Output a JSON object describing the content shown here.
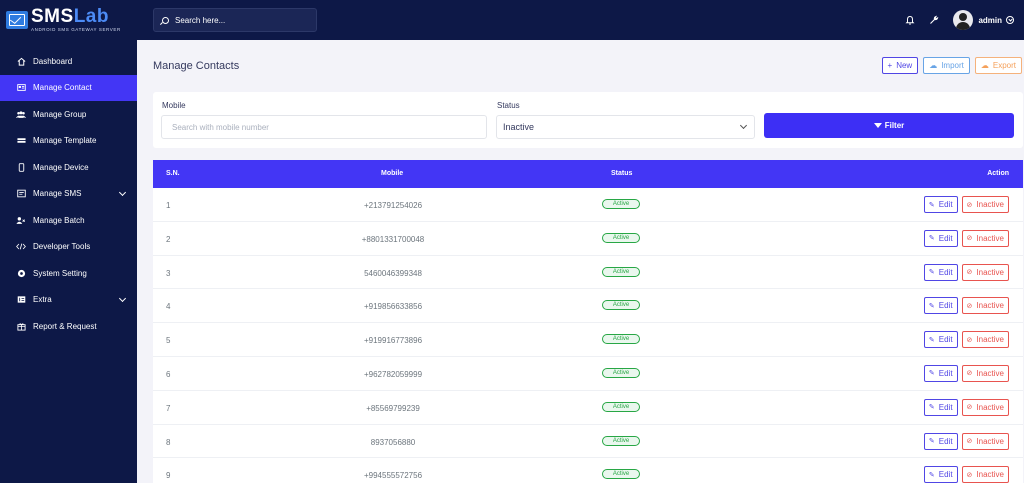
{
  "brand": {
    "name_main": "SMS",
    "name_accent": "Lab",
    "tagline": "ANDROID SMS GATEWAY SERVER"
  },
  "sidebar": {
    "items": [
      {
        "label": "Dashboard",
        "icon": "home-icon"
      },
      {
        "label": "Manage Contact",
        "icon": "contact-card-icon",
        "active": true
      },
      {
        "label": "Manage Group",
        "icon": "group-icon"
      },
      {
        "label": "Manage Template",
        "icon": "template-icon"
      },
      {
        "label": "Manage Device",
        "icon": "phone-icon"
      },
      {
        "label": "Manage SMS",
        "icon": "message-icon",
        "has_submenu": true
      },
      {
        "label": "Manage Batch",
        "icon": "batch-icon"
      },
      {
        "label": "Developer Tools",
        "icon": "code-icon"
      },
      {
        "label": "System Setting",
        "icon": "settings-icon"
      },
      {
        "label": "Extra",
        "icon": "extra-icon",
        "has_submenu": true
      },
      {
        "label": "Report & Request",
        "icon": "report-icon"
      }
    ]
  },
  "topbar": {
    "search_placeholder": "Search here...",
    "user_name": "admin"
  },
  "page": {
    "title": "Manage Contacts",
    "buttons": {
      "new": "New",
      "import": "Import",
      "export": "Export"
    }
  },
  "filter": {
    "mobile_label": "Mobile",
    "mobile_placeholder": "Search with mobile number",
    "status_label": "Status",
    "status_value": "Inactive",
    "filter_button": "Filter"
  },
  "table": {
    "headers": {
      "sn": "S.N.",
      "mobile": "Mobile",
      "status": "Status",
      "action": "Action"
    },
    "edit_label": "Edit",
    "inactive_label": "Inactive",
    "rows": [
      {
        "sn": "1",
        "mobile": "+213791254026",
        "status": "Active"
      },
      {
        "sn": "2",
        "mobile": "+8801331700048",
        "status": "Active"
      },
      {
        "sn": "3",
        "mobile": "5460046399348",
        "status": "Active"
      },
      {
        "sn": "4",
        "mobile": "+919856633856",
        "status": "Active"
      },
      {
        "sn": "5",
        "mobile": "+919916773896",
        "status": "Active"
      },
      {
        "sn": "6",
        "mobile": "+962782059999",
        "status": "Active"
      },
      {
        "sn": "7",
        "mobile": "+85569799239",
        "status": "Active"
      },
      {
        "sn": "8",
        "mobile": "8937056880",
        "status": "Active"
      },
      {
        "sn": "9",
        "mobile": "+994555572756",
        "status": "Active"
      }
    ]
  },
  "colors": {
    "sidebar_bg": "#0d1847",
    "accent": "#4336f5",
    "success": "#28a745",
    "danger": "#e8544f"
  }
}
